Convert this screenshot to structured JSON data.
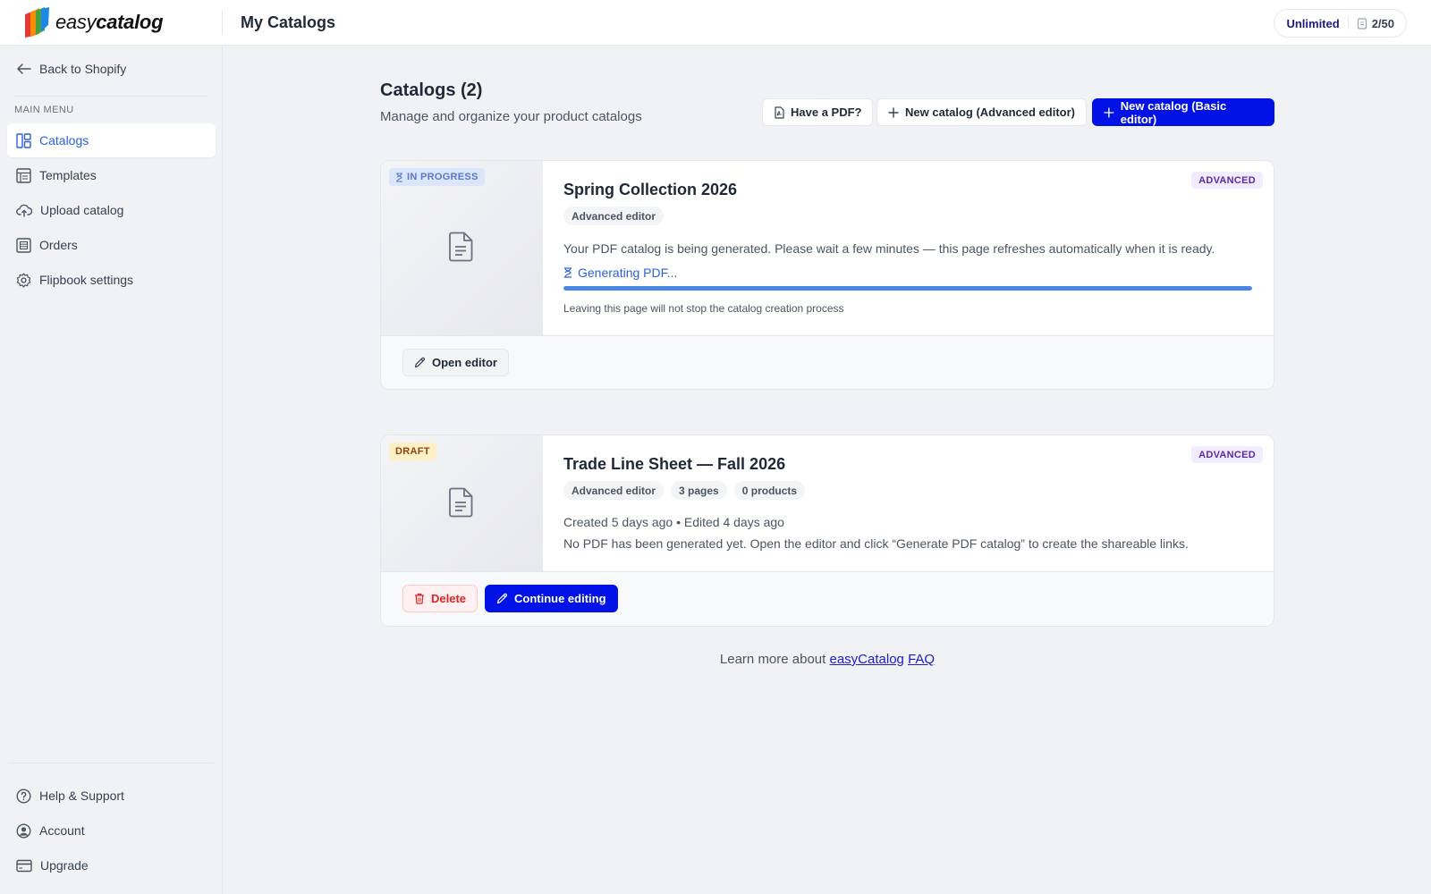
{
  "header": {
    "brand_light": "easy",
    "brand_bold": "catalog",
    "page_title": "My Catalogs",
    "plan": "Unlimited",
    "usage": "2/50"
  },
  "sidebar": {
    "back": "Back to Shopify",
    "section": "MAIN MENU",
    "items": [
      {
        "label": "Catalogs",
        "icon": "layout-grid-icon",
        "active": true
      },
      {
        "label": "Templates",
        "icon": "table-icon"
      },
      {
        "label": "Upload catalog",
        "icon": "cloud-upload-icon"
      },
      {
        "label": "Orders",
        "icon": "orders-icon"
      },
      {
        "label": "Flipbook settings",
        "icon": "gear-icon"
      }
    ],
    "bottom": [
      {
        "label": "Help & Support",
        "icon": "help-circle-icon"
      },
      {
        "label": "Account",
        "icon": "user-circle-icon"
      },
      {
        "label": "Upgrade",
        "icon": "credit-card-icon"
      }
    ]
  },
  "main": {
    "title": "Catalogs (2)",
    "subtitle": "Manage and organize your product catalogs",
    "actions": {
      "have_pdf": "Have a PDF?",
      "new_advanced": "New catalog (Advanced editor)",
      "new_basic": "New catalog (Basic editor)"
    }
  },
  "catalogs": [
    {
      "status": "IN PROGRESS",
      "tier": "ADVANCED",
      "title": "Spring Collection 2026",
      "chips": [
        "Advanced editor"
      ],
      "message": "Your PDF catalog is being generated. Please wait a few minutes — this page refreshes automatically when it is ready.",
      "generating": "Generating PDF...",
      "progress": 1.0,
      "note": "Leaving this page will not stop the catalog creation process",
      "open_editor": "Open editor"
    },
    {
      "status": "DRAFT",
      "tier": "ADVANCED",
      "title": "Trade Line Sheet — Fall 2026",
      "chips": [
        "Advanced editor",
        "3 pages",
        "0 products"
      ],
      "meta": "Created 5 days ago • Edited 4 days ago",
      "message": "No PDF has been generated yet. Open the editor and click “Generate PDF catalog” to create the shareable links.",
      "delete": "Delete",
      "continue": "Continue editing"
    }
  ],
  "footer": {
    "prefix": "Learn more about",
    "link1": "easyCatalog",
    "link2": "FAQ"
  },
  "colors": {
    "primary": "#0012e6",
    "accent": "#2b5fd9",
    "progress": "#4a86e8",
    "danger": "#dc2626"
  }
}
